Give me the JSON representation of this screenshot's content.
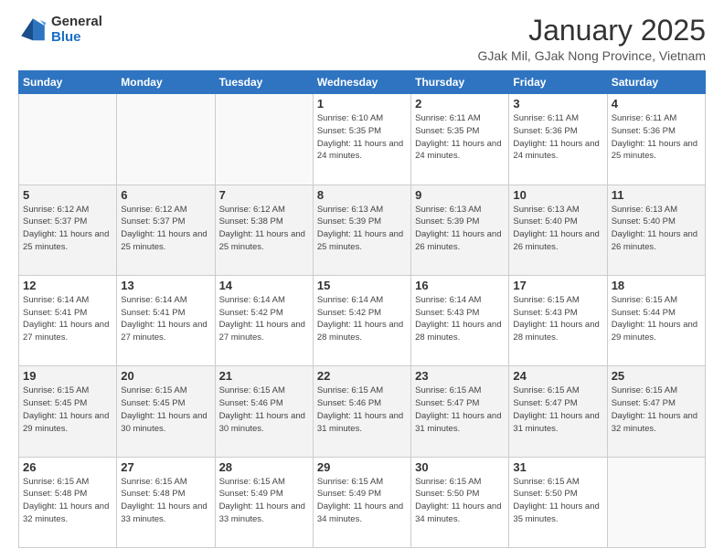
{
  "logo": {
    "general": "General",
    "blue": "Blue"
  },
  "title": "January 2025",
  "location": "GJak Mil, GJak Nong Province, Vietnam",
  "days_of_week": [
    "Sunday",
    "Monday",
    "Tuesday",
    "Wednesday",
    "Thursday",
    "Friday",
    "Saturday"
  ],
  "weeks": [
    [
      {
        "day": "",
        "sunrise": "",
        "sunset": "",
        "daylight": "",
        "empty": true
      },
      {
        "day": "",
        "sunrise": "",
        "sunset": "",
        "daylight": "",
        "empty": true
      },
      {
        "day": "",
        "sunrise": "",
        "sunset": "",
        "daylight": "",
        "empty": true
      },
      {
        "day": "1",
        "sunrise": "Sunrise: 6:10 AM",
        "sunset": "Sunset: 5:35 PM",
        "daylight": "Daylight: 11 hours and 24 minutes.",
        "empty": false
      },
      {
        "day": "2",
        "sunrise": "Sunrise: 6:11 AM",
        "sunset": "Sunset: 5:35 PM",
        "daylight": "Daylight: 11 hours and 24 minutes.",
        "empty": false
      },
      {
        "day": "3",
        "sunrise": "Sunrise: 6:11 AM",
        "sunset": "Sunset: 5:36 PM",
        "daylight": "Daylight: 11 hours and 24 minutes.",
        "empty": false
      },
      {
        "day": "4",
        "sunrise": "Sunrise: 6:11 AM",
        "sunset": "Sunset: 5:36 PM",
        "daylight": "Daylight: 11 hours and 25 minutes.",
        "empty": false
      }
    ],
    [
      {
        "day": "5",
        "sunrise": "Sunrise: 6:12 AM",
        "sunset": "Sunset: 5:37 PM",
        "daylight": "Daylight: 11 hours and 25 minutes.",
        "empty": false
      },
      {
        "day": "6",
        "sunrise": "Sunrise: 6:12 AM",
        "sunset": "Sunset: 5:37 PM",
        "daylight": "Daylight: 11 hours and 25 minutes.",
        "empty": false
      },
      {
        "day": "7",
        "sunrise": "Sunrise: 6:12 AM",
        "sunset": "Sunset: 5:38 PM",
        "daylight": "Daylight: 11 hours and 25 minutes.",
        "empty": false
      },
      {
        "day": "8",
        "sunrise": "Sunrise: 6:13 AM",
        "sunset": "Sunset: 5:39 PM",
        "daylight": "Daylight: 11 hours and 25 minutes.",
        "empty": false
      },
      {
        "day": "9",
        "sunrise": "Sunrise: 6:13 AM",
        "sunset": "Sunset: 5:39 PM",
        "daylight": "Daylight: 11 hours and 26 minutes.",
        "empty": false
      },
      {
        "day": "10",
        "sunrise": "Sunrise: 6:13 AM",
        "sunset": "Sunset: 5:40 PM",
        "daylight": "Daylight: 11 hours and 26 minutes.",
        "empty": false
      },
      {
        "day": "11",
        "sunrise": "Sunrise: 6:13 AM",
        "sunset": "Sunset: 5:40 PM",
        "daylight": "Daylight: 11 hours and 26 minutes.",
        "empty": false
      }
    ],
    [
      {
        "day": "12",
        "sunrise": "Sunrise: 6:14 AM",
        "sunset": "Sunset: 5:41 PM",
        "daylight": "Daylight: 11 hours and 27 minutes.",
        "empty": false
      },
      {
        "day": "13",
        "sunrise": "Sunrise: 6:14 AM",
        "sunset": "Sunset: 5:41 PM",
        "daylight": "Daylight: 11 hours and 27 minutes.",
        "empty": false
      },
      {
        "day": "14",
        "sunrise": "Sunrise: 6:14 AM",
        "sunset": "Sunset: 5:42 PM",
        "daylight": "Daylight: 11 hours and 27 minutes.",
        "empty": false
      },
      {
        "day": "15",
        "sunrise": "Sunrise: 6:14 AM",
        "sunset": "Sunset: 5:42 PM",
        "daylight": "Daylight: 11 hours and 28 minutes.",
        "empty": false
      },
      {
        "day": "16",
        "sunrise": "Sunrise: 6:14 AM",
        "sunset": "Sunset: 5:43 PM",
        "daylight": "Daylight: 11 hours and 28 minutes.",
        "empty": false
      },
      {
        "day": "17",
        "sunrise": "Sunrise: 6:15 AM",
        "sunset": "Sunset: 5:43 PM",
        "daylight": "Daylight: 11 hours and 28 minutes.",
        "empty": false
      },
      {
        "day": "18",
        "sunrise": "Sunrise: 6:15 AM",
        "sunset": "Sunset: 5:44 PM",
        "daylight": "Daylight: 11 hours and 29 minutes.",
        "empty": false
      }
    ],
    [
      {
        "day": "19",
        "sunrise": "Sunrise: 6:15 AM",
        "sunset": "Sunset: 5:45 PM",
        "daylight": "Daylight: 11 hours and 29 minutes.",
        "empty": false
      },
      {
        "day": "20",
        "sunrise": "Sunrise: 6:15 AM",
        "sunset": "Sunset: 5:45 PM",
        "daylight": "Daylight: 11 hours and 30 minutes.",
        "empty": false
      },
      {
        "day": "21",
        "sunrise": "Sunrise: 6:15 AM",
        "sunset": "Sunset: 5:46 PM",
        "daylight": "Daylight: 11 hours and 30 minutes.",
        "empty": false
      },
      {
        "day": "22",
        "sunrise": "Sunrise: 6:15 AM",
        "sunset": "Sunset: 5:46 PM",
        "daylight": "Daylight: 11 hours and 31 minutes.",
        "empty": false
      },
      {
        "day": "23",
        "sunrise": "Sunrise: 6:15 AM",
        "sunset": "Sunset: 5:47 PM",
        "daylight": "Daylight: 11 hours and 31 minutes.",
        "empty": false
      },
      {
        "day": "24",
        "sunrise": "Sunrise: 6:15 AM",
        "sunset": "Sunset: 5:47 PM",
        "daylight": "Daylight: 11 hours and 31 minutes.",
        "empty": false
      },
      {
        "day": "25",
        "sunrise": "Sunrise: 6:15 AM",
        "sunset": "Sunset: 5:47 PM",
        "daylight": "Daylight: 11 hours and 32 minutes.",
        "empty": false
      }
    ],
    [
      {
        "day": "26",
        "sunrise": "Sunrise: 6:15 AM",
        "sunset": "Sunset: 5:48 PM",
        "daylight": "Daylight: 11 hours and 32 minutes.",
        "empty": false
      },
      {
        "day": "27",
        "sunrise": "Sunrise: 6:15 AM",
        "sunset": "Sunset: 5:48 PM",
        "daylight": "Daylight: 11 hours and 33 minutes.",
        "empty": false
      },
      {
        "day": "28",
        "sunrise": "Sunrise: 6:15 AM",
        "sunset": "Sunset: 5:49 PM",
        "daylight": "Daylight: 11 hours and 33 minutes.",
        "empty": false
      },
      {
        "day": "29",
        "sunrise": "Sunrise: 6:15 AM",
        "sunset": "Sunset: 5:49 PM",
        "daylight": "Daylight: 11 hours and 34 minutes.",
        "empty": false
      },
      {
        "day": "30",
        "sunrise": "Sunrise: 6:15 AM",
        "sunset": "Sunset: 5:50 PM",
        "daylight": "Daylight: 11 hours and 34 minutes.",
        "empty": false
      },
      {
        "day": "31",
        "sunrise": "Sunrise: 6:15 AM",
        "sunset": "Sunset: 5:50 PM",
        "daylight": "Daylight: 11 hours and 35 minutes.",
        "empty": false
      },
      {
        "day": "",
        "sunrise": "",
        "sunset": "",
        "daylight": "",
        "empty": true
      }
    ]
  ]
}
